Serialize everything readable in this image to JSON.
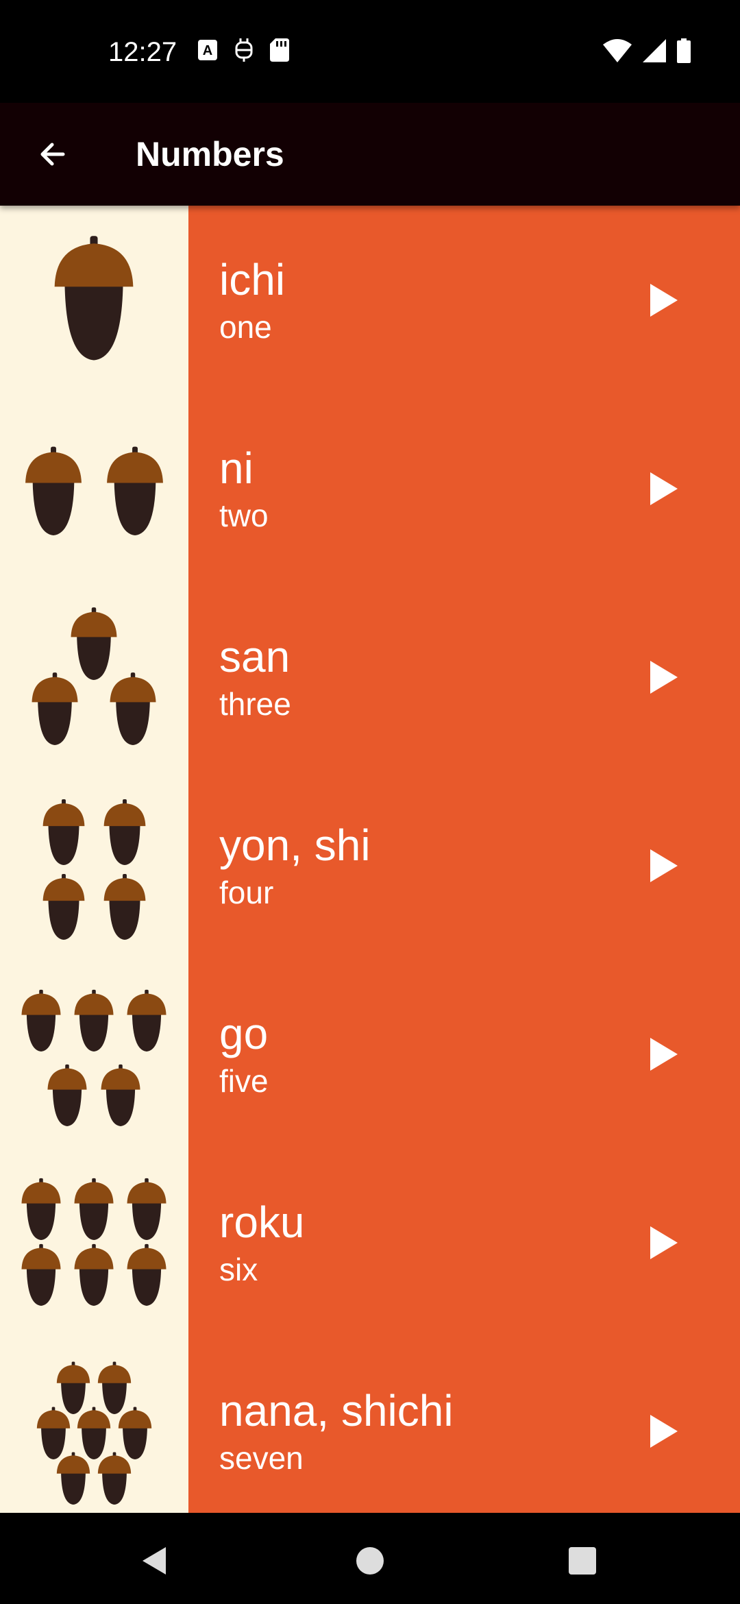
{
  "status_bar": {
    "time": "12:27",
    "left_icons": [
      "keyboard-a-icon",
      "robot-icon",
      "sd-card-icon"
    ],
    "right_icons": [
      "wifi-icon",
      "signal-icon",
      "battery-icon"
    ]
  },
  "app_bar": {
    "title": "Numbers",
    "back_icon": "arrow-left-icon"
  },
  "colors": {
    "image_bg": "#fdf5e0",
    "row_bg": "#e8592b",
    "app_bar_bg": "#120003",
    "acorn_cap": "#8b4a12",
    "acorn_body": "#2e1e1b"
  },
  "items": [
    {
      "word": "ichi",
      "translation": "one",
      "acorn_count": 1
    },
    {
      "word": "ni",
      "translation": "two",
      "acorn_count": 2
    },
    {
      "word": "san",
      "translation": "three",
      "acorn_count": 3
    },
    {
      "word": "yon, shi",
      "translation": "four",
      "acorn_count": 4
    },
    {
      "word": "go",
      "translation": "five",
      "acorn_count": 5
    },
    {
      "word": "roku",
      "translation": "six",
      "acorn_count": 6
    },
    {
      "word": "nana, shichi",
      "translation": "seven",
      "acorn_count": 7
    }
  ],
  "nav_bar": {
    "back_icon": "nav-back-icon",
    "home_icon": "nav-home-icon",
    "recents_icon": "nav-recents-icon"
  }
}
